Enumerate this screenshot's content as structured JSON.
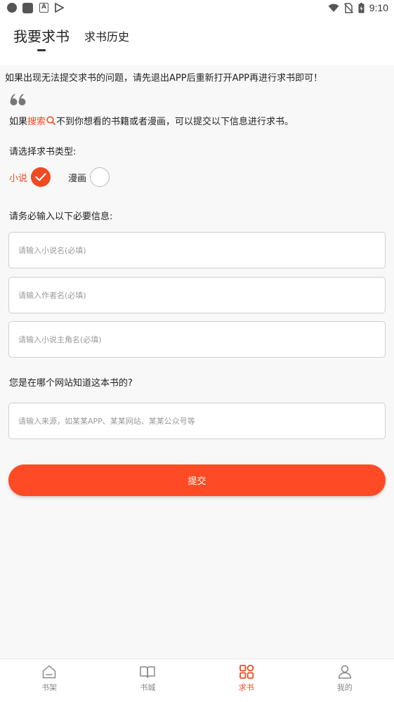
{
  "status_bar": {
    "time": "9:10"
  },
  "tabs": {
    "active": "我要求书",
    "other": "求书历史"
  },
  "notice": "如果出现无法提交求书的问题，请先退出APP后重新打开APP再进行求书即可！",
  "intro": {
    "prefix": "如果",
    "search_word": "搜索",
    "suffix": "不到你想看的书籍或者漫画，可以提交以下信息进行求书。"
  },
  "type_section": {
    "label": "请选择求书类型:",
    "options": [
      {
        "label": "小说",
        "selected": true
      },
      {
        "label": "漫画",
        "selected": false
      }
    ]
  },
  "required_label": "请务必输入以下必要信息:",
  "fields": {
    "novel_name": {
      "value": "",
      "placeholder": "请输入小说名(必填)"
    },
    "author_name": {
      "value": "",
      "placeholder": "请输入作者名(必填)"
    },
    "protagonist_name": {
      "value": "",
      "placeholder": "请输入小说主角名(必填)"
    },
    "source": {
      "value": "",
      "placeholder": "请输入来源，如某某APP、某某网站、某某公众号等"
    }
  },
  "source_label": "您是在哪个网站知道这本书的?",
  "submit_label": "提交",
  "nav": [
    {
      "label": "书架",
      "icon": "bookshelf-icon",
      "active": false
    },
    {
      "label": "书城",
      "icon": "book-open-icon",
      "active": false
    },
    {
      "label": "求书",
      "icon": "grid-icon",
      "active": true
    },
    {
      "label": "我的",
      "icon": "user-icon",
      "active": false
    }
  ],
  "colors": {
    "accent": "#f04a22",
    "button": "#ff4b25"
  }
}
